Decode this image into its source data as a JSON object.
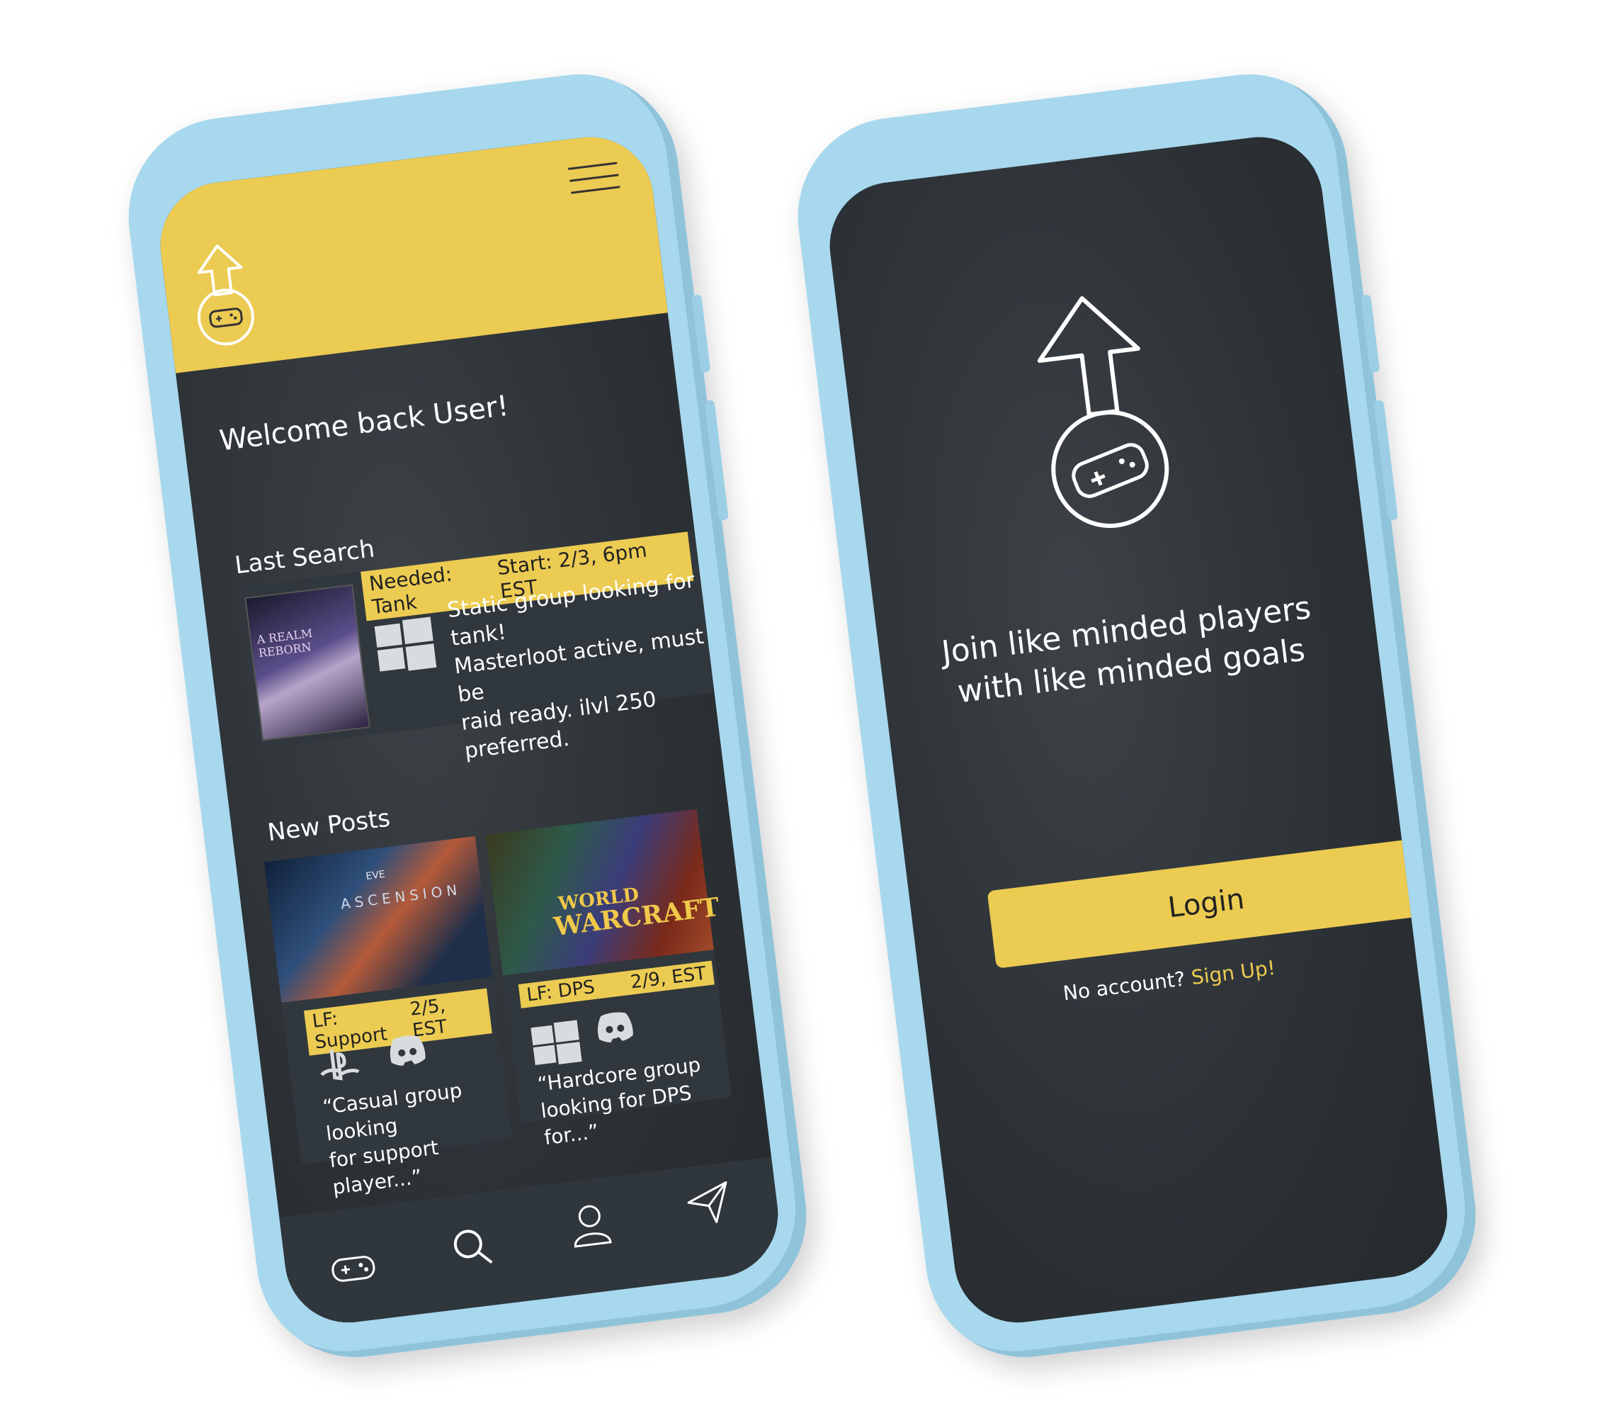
{
  "left_screen": {
    "welcome": "Welcome back User!",
    "last_search_title": "Last Search",
    "last_search": {
      "game_cover_text": "A REALM REBORN",
      "needed": "Needed: Tank",
      "start": "Start: 2/3, 6pm EST",
      "platform_icon": "windows-icon",
      "description_lines": [
        "Static group looking for tank!",
        "Masterloot active, must be",
        "raid ready. ilvl 250 preferred."
      ]
    },
    "new_posts_title": "New Posts",
    "posts": [
      {
        "cover_title": "ASCENSION",
        "cover_brand": "EVE",
        "lf": "LF: Support",
        "date": "2/5, EST",
        "icons": [
          "playstation-icon",
          "discord-icon"
        ],
        "snippet_lines": [
          "“Casual group looking",
          "for support player...”"
        ]
      },
      {
        "cover_title_1": "WORLD",
        "cover_title_2": "WARCRAFT",
        "lf": "LF: DPS",
        "date": "2/9, EST",
        "icons": [
          "windows-icon",
          "discord-icon"
        ],
        "snippet_lines": [
          "“Hardcore group",
          "looking for DPS for...”"
        ]
      }
    ],
    "nav": [
      "gamepad-icon",
      "search-icon",
      "profile-icon",
      "send-icon"
    ]
  },
  "right_screen": {
    "tagline_lines": [
      "Join like minded players",
      "with like minded goals"
    ],
    "login_label": "Login",
    "no_account": "No account?",
    "signup": "Sign Up!"
  },
  "colors": {
    "accent": "#eccb52",
    "phone": "#a7d8ee",
    "screen": "#2c3136"
  }
}
